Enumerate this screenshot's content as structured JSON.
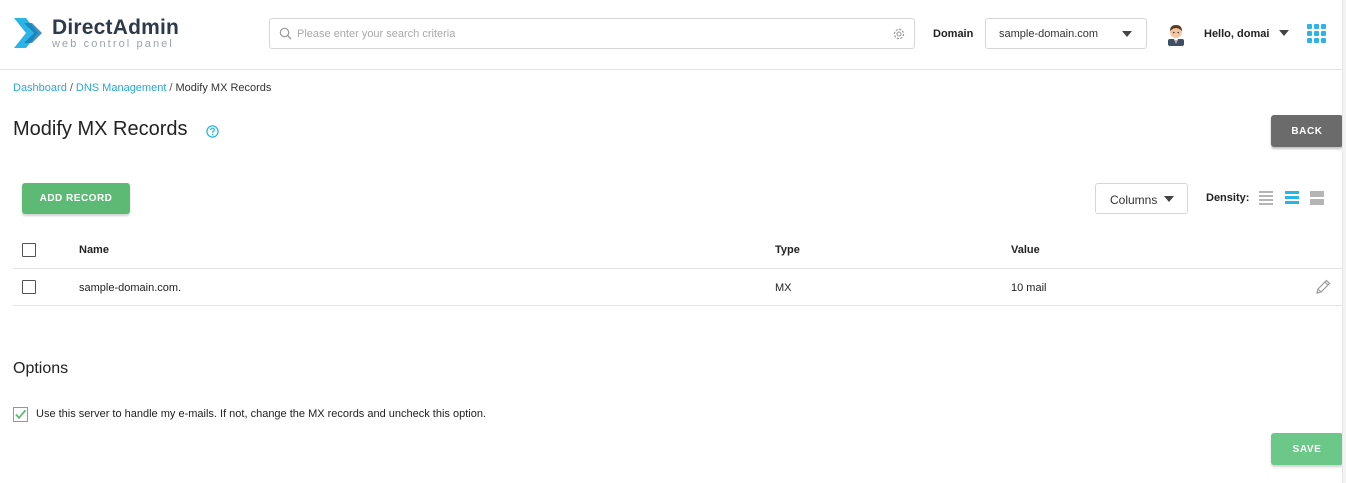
{
  "colors": {
    "accent": "#2bb5e6",
    "success": "#5cba75",
    "back_button": "#6b6b6b",
    "link": "#2aa8d8"
  },
  "header": {
    "logo_title": "DirectAdmin",
    "logo_subtitle": "web control panel",
    "search_placeholder": "Please enter your search criteria",
    "search_icon": "search-icon",
    "settings_icon": "gear-icon",
    "domain_label": "Domain",
    "domain_value": "sample-domain.com",
    "user_greeting": "Hello, domai",
    "apps_icon": "grid-icon"
  },
  "breadcrumb": {
    "items": [
      "Dashboard",
      "DNS Management",
      "Modify MX Records"
    ],
    "separator": "/"
  },
  "page": {
    "title": "Modify MX Records",
    "help_icon": "question-circle-icon",
    "back_label": "BACK"
  },
  "toolbar": {
    "add_label": "ADD RECORD",
    "columns_label": "Columns",
    "density_label": "Density:",
    "density_options": [
      "compact",
      "default",
      "comfortable"
    ],
    "density_selected": "default"
  },
  "table": {
    "headers": {
      "name": "Name",
      "type": "Type",
      "value": "Value"
    },
    "rows": [
      {
        "name": "sample-domain.com.",
        "type": "MX",
        "value": "10 mail"
      }
    ]
  },
  "options": {
    "title": "Options",
    "handle_email_label": "Use this server to handle my e-mails. If not, change the MX records and uncheck this option.",
    "handle_email_checked": true
  },
  "footer": {
    "save_label": "SAVE"
  }
}
